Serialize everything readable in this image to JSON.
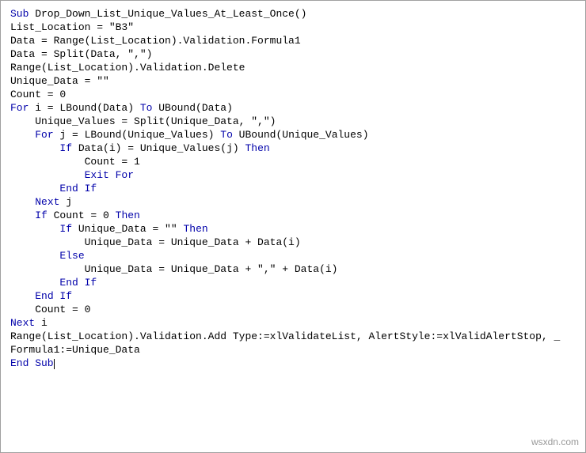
{
  "code": {
    "l1_kw1": "Sub",
    "l1_rest": " Drop_Down_List_Unique_Values_At_Least_Once()",
    "l2": "",
    "l3": "List_Location = \"B3\"",
    "l4": "",
    "l5": "Data = Range(List_Location).Validation.Formula1",
    "l6": "Data = Split(Data, \",\")",
    "l7": "",
    "l8": "Range(List_Location).Validation.Delete",
    "l9": "",
    "l10": "Unique_Data = \"\"",
    "l11": "",
    "l12": "Count = 0",
    "l13": "",
    "l14_kw1": "For",
    "l14_mid1": " i = LBound(Data) ",
    "l14_kw2": "To",
    "l14_mid2": " UBound(Data)",
    "l15": "    Unique_Values = Split(Unique_Data, \",\")",
    "l16_pre": "    ",
    "l16_kw1": "For",
    "l16_mid1": " j = LBound(Unique_Values) ",
    "l16_kw2": "To",
    "l16_mid2": " UBound(Unique_Values)",
    "l17_pre": "        ",
    "l17_kw1": "If",
    "l17_mid": " Data(i) = Unique_Values(j) ",
    "l17_kw2": "Then",
    "l18": "            Count = 1",
    "l19_pre": "            ",
    "l19_kw": "Exit For",
    "l20_pre": "        ",
    "l20_kw": "End If",
    "l21_pre": "    ",
    "l21_kw": "Next",
    "l21_rest": " j",
    "l22_pre": "    ",
    "l22_kw1": "If",
    "l22_mid": " Count = 0 ",
    "l22_kw2": "Then",
    "l23_pre": "        ",
    "l23_kw1": "If",
    "l23_mid": " Unique_Data = \"\" ",
    "l23_kw2": "Then",
    "l24": "            Unique_Data = Unique_Data + Data(i)",
    "l25_pre": "        ",
    "l25_kw": "Else",
    "l26": "            Unique_Data = Unique_Data + \",\" + Data(i)",
    "l27_pre": "        ",
    "l27_kw": "End If",
    "l28_pre": "    ",
    "l28_kw": "End If",
    "l29": "    Count = 0",
    "l30_kw": "Next",
    "l30_rest": " i",
    "l31": "",
    "l32": "Range(List_Location).Validation.Add Type:=xlValidateList, AlertStyle:=xlValidAlertStop, _",
    "l33": "Formula1:=Unique_Data",
    "l34": "",
    "l35_kw": "End Sub"
  },
  "watermark": "wsxdn.com"
}
